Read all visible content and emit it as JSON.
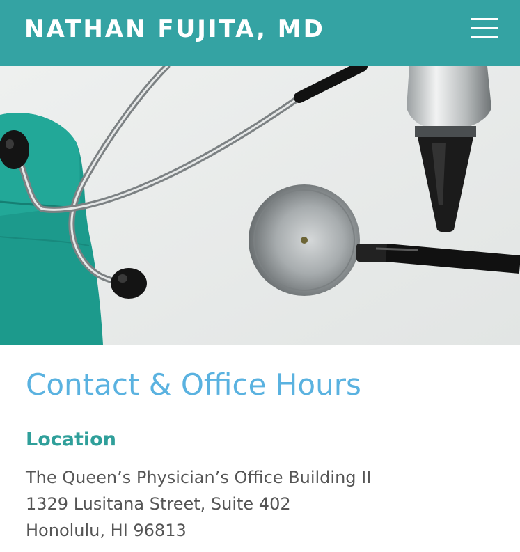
{
  "header": {
    "site_title": "NATHAN FUJITA, MD",
    "menu_icon": "hamburger-menu-icon",
    "background_color": "#34a3a3"
  },
  "hero": {
    "image_subject": "stethoscope-and-otoscope-on-teal-scrubs"
  },
  "main": {
    "page_title": "Contact & Office Hours",
    "title_color": "#5ab2e0",
    "location": {
      "heading": "Location",
      "heading_color": "#2f9f9a",
      "address_lines": [
        "The Queen’s Physician’s Office Building II",
        "1329 Lusitana Street, Suite 402",
        "Honolulu, HI 96813"
      ]
    }
  }
}
